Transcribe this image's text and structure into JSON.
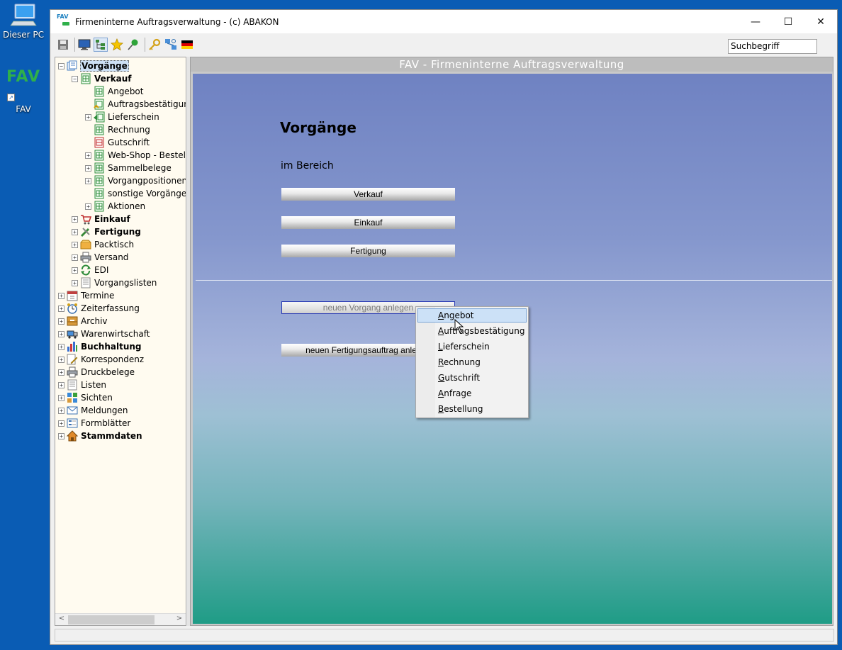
{
  "desktop": {
    "icons": [
      {
        "label": "Dieser PC",
        "icon": "computer-icon"
      },
      {
        "label": "FAV",
        "logo_text": "FAV",
        "icon": "fav-shortcut-icon"
      }
    ]
  },
  "window": {
    "title": "Firmeninterne Auftragsverwaltung - (c) ABAKON",
    "app_icon_text": "FAV",
    "controls": {
      "minimize": "—",
      "maximize": "☐",
      "close": "✕"
    }
  },
  "toolbar": {
    "icons": [
      "save-icon",
      "monitor-icon",
      "tree-view-icon",
      "star-icon",
      "pin-icon",
      "key-icon",
      "network-icon",
      "german-flag-icon"
    ],
    "search_value": "Suchbegriff"
  },
  "tree": {
    "items": [
      {
        "label": "Vorgänge",
        "level": 0,
        "exp": "−",
        "bold": true,
        "selected": true,
        "icon": "documents-icon"
      },
      {
        "label": "Verkauf",
        "level": 1,
        "exp": "−",
        "bold": true,
        "icon": "sheet-icon"
      },
      {
        "label": "Angebot",
        "level": 2,
        "exp": "",
        "icon": "sheet-icon"
      },
      {
        "label": "Auftragsbestätigung",
        "level": 2,
        "exp": "",
        "icon": "sheet-check-icon"
      },
      {
        "label": "Lieferschein",
        "level": 2,
        "exp": "+",
        "icon": "sheet-arrow-icon"
      },
      {
        "label": "Rechnung",
        "level": 2,
        "exp": "",
        "icon": "sheet-icon"
      },
      {
        "label": "Gutschrift",
        "level": 2,
        "exp": "",
        "icon": "sheet-red-icon"
      },
      {
        "label": "Web-Shop - Bestellungen",
        "level": 2,
        "exp": "+",
        "icon": "sheet-icon"
      },
      {
        "label": "Sammelbelege",
        "level": 2,
        "exp": "+",
        "icon": "sheet-icon"
      },
      {
        "label": "Vorgangpositionen",
        "level": 2,
        "exp": "+",
        "icon": "sheet-icon"
      },
      {
        "label": "sonstige Vorgänge",
        "level": 2,
        "exp": "",
        "icon": "sheet-icon"
      },
      {
        "label": "Aktionen",
        "level": 2,
        "exp": "+",
        "icon": "sheet-icon"
      },
      {
        "label": "Einkauf",
        "level": 1,
        "exp": "+",
        "bold": true,
        "icon": "cart-icon"
      },
      {
        "label": "Fertigung",
        "level": 1,
        "exp": "+",
        "bold": true,
        "icon": "tools-icon"
      },
      {
        "label": "Packtisch",
        "level": 1,
        "exp": "+",
        "icon": "box-icon"
      },
      {
        "label": "Versand",
        "level": 1,
        "exp": "+",
        "icon": "printer-icon"
      },
      {
        "label": "EDI",
        "level": 1,
        "exp": "+",
        "icon": "sync-icon"
      },
      {
        "label": "Vorgangslisten",
        "level": 1,
        "exp": "+",
        "icon": "list-doc-icon"
      },
      {
        "label": "Termine",
        "level": 0,
        "exp": "+",
        "icon": "calendar-icon"
      },
      {
        "label": "Zeiterfassung",
        "level": 0,
        "exp": "+",
        "icon": "clock-icon"
      },
      {
        "label": "Archiv",
        "level": 0,
        "exp": "+",
        "icon": "archive-icon"
      },
      {
        "label": "Warenwirtschaft",
        "level": 0,
        "exp": "+",
        "icon": "truck-icon"
      },
      {
        "label": "Buchhaltung",
        "level": 0,
        "exp": "+",
        "bold": true,
        "icon": "bar-chart-icon"
      },
      {
        "label": "Korrespondenz",
        "level": 0,
        "exp": "+",
        "icon": "pen-doc-icon"
      },
      {
        "label": "Druckbelege",
        "level": 0,
        "exp": "+",
        "icon": "printer-icon"
      },
      {
        "label": "Listen",
        "level": 0,
        "exp": "+",
        "icon": "list-doc-icon"
      },
      {
        "label": "Sichten",
        "level": 0,
        "exp": "+",
        "icon": "grid-icon"
      },
      {
        "label": "Meldungen",
        "level": 0,
        "exp": "+",
        "icon": "mail-icon"
      },
      {
        "label": "Formblätter",
        "level": 0,
        "exp": "+",
        "icon": "form-icon"
      },
      {
        "label": "Stammdaten",
        "level": 0,
        "exp": "+",
        "bold": true,
        "icon": "house-icon"
      }
    ]
  },
  "content": {
    "header": "FAV - Firmeninterne Auftragsverwaltung",
    "title": "Vorgänge",
    "subtitle": "im Bereich",
    "buttons": {
      "verkauf": "Verkauf",
      "einkauf": "Einkauf",
      "fertigung": "Fertigung",
      "neuer_vorgang": "neuen Vorgang anlegen",
      "neuer_fertigungsauftrag": "neuen Fertigungsauftrag anlegen"
    }
  },
  "context_menu": {
    "items": [
      {
        "label": "Angebot",
        "highlighted": true
      },
      {
        "label": "Auftragsbestätigung"
      },
      {
        "label": "Lieferschein"
      },
      {
        "label": "Rechnung"
      },
      {
        "label": "Gutschrift"
      },
      {
        "label": "Anfrage"
      },
      {
        "label": "Bestellung"
      }
    ]
  },
  "colors": {
    "desktop": "#0a5cb4",
    "tree_background": "#fffbf0",
    "panel_top": "#6f82c2",
    "panel_bottom": "#1f9c86",
    "menu_highlight": "#cce1f7",
    "logo_green": "#2fb04a"
  }
}
